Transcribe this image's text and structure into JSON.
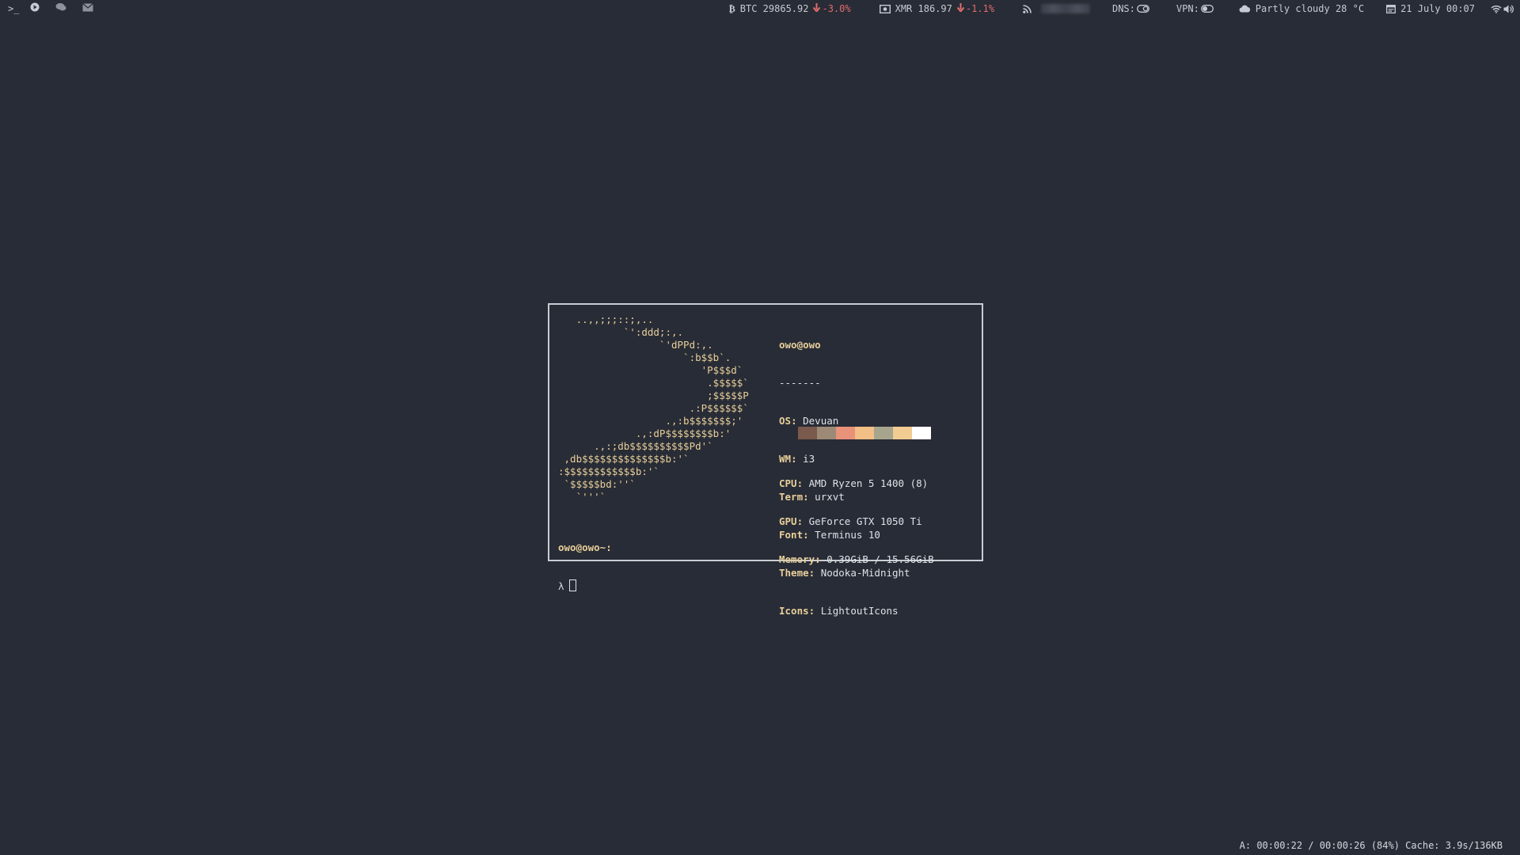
{
  "topbar": {
    "left_icons": [
      "terminal-icon",
      "play-icon",
      "chat-icon",
      "mail-icon"
    ],
    "btc": {
      "label": "BTC 29865.92",
      "change": "-3.0%"
    },
    "xmr": {
      "label": "XMR 186.97",
      "change": "-1.1%"
    },
    "dns": {
      "label": "DNS:"
    },
    "vpn": {
      "label": "VPN:"
    },
    "weather": "Partly cloudy 28 °C",
    "datetime": "21 July 00:07"
  },
  "terminal": {
    "ascii_lines": [
      "   ..,,;;;::;,..",
      "           `':ddd;:,.",
      "                 `'dPPd:,.",
      "                     `:b$$b`.",
      "                        'P$$$d`",
      "                         .$$$$$`",
      "                         ;$$$$$P",
      "                      .:P$$$$$$`",
      "                  .,:b$$$$$$$;'",
      "             .,:dP$$$$$$$$b:'",
      "      .,:;db$$$$$$$$$$Pd'`",
      " ,db$$$$$$$$$$$$$$b:'`",
      ":$$$$$$$$$$$$b:'`",
      " `$$$$$bd:''`",
      "   `'''`"
    ],
    "header": "owo@owo",
    "separator": "-------",
    "info": [
      {
        "key": "OS",
        "value": "Devuan"
      },
      {
        "key": "WM",
        "value": "i3"
      },
      {
        "key": "Term",
        "value": "urxvt"
      },
      {
        "key": "Font",
        "value": "Terminus 10"
      },
      {
        "key": "Theme",
        "value": "Nodoka-Midnight"
      },
      {
        "key": "Icons",
        "value": "LightoutIcons"
      }
    ],
    "palette_colors": [
      "#7a5a4c",
      "#9c8a76",
      "#e8927a",
      "#f2bf86",
      "#a8a58e",
      "#f2cc92",
      "#ffffff"
    ],
    "hardware": [
      {
        "key": "CPU",
        "value": "AMD Ryzen 5 1400 (8)"
      },
      {
        "key": "GPU",
        "value": "GeForce GTX 1050 Ti"
      },
      {
        "key": "Memory",
        "value": "0.39GiB / 15.56GiB"
      }
    ],
    "prompt_host": "owo@owo~:",
    "prompt_symbol": "λ"
  },
  "status_bottom": "A: 00:00:22 / 00:00:26 (84%) Cache: 3.9s/136KB"
}
